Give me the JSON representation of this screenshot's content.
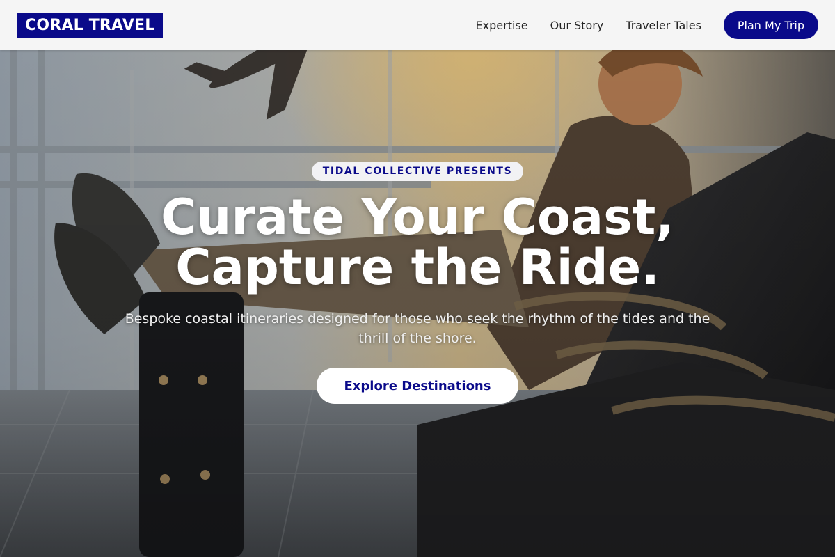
{
  "header": {
    "logo": "CORAL TRAVEL",
    "nav": [
      {
        "label": "Expertise"
      },
      {
        "label": "Our Story"
      },
      {
        "label": "Traveler Tales"
      }
    ],
    "cta_label": "Plan My Trip"
  },
  "hero": {
    "badge": "TIDAL COLLECTIVE PRESENTS",
    "headline_line1": "Curate Your Coast,",
    "headline_line2": "Capture the Ride.",
    "subtext": "Bespoke coastal itineraries designed for those who seek the rhythm of the tides and the thrill of the shore.",
    "button_label": "Explore Destinations"
  },
  "colors": {
    "brand": "#0a0a8a",
    "header_bg": "#f5f5f5",
    "badge_bg": "#f2f2f4",
    "button_bg": "#ffffff"
  }
}
